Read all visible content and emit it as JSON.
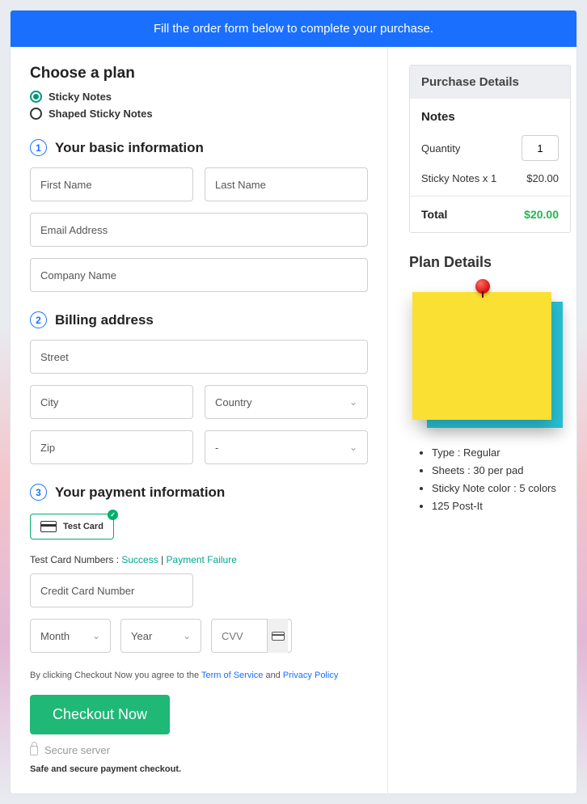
{
  "banner": "Fill the order form below to complete your purchase.",
  "plan": {
    "heading": "Choose a plan",
    "options": [
      "Sticky Notes",
      "Shaped Sticky Notes"
    ]
  },
  "steps": {
    "s1": {
      "num": "1",
      "title": "Your basic information",
      "first": "First Name",
      "last": "Last Name",
      "email": "Email Address",
      "company": "Company Name"
    },
    "s2": {
      "num": "2",
      "title": "Billing address",
      "street": "Street",
      "city": "City",
      "country": "Country",
      "zip": "Zip",
      "state": "-"
    },
    "s3": {
      "num": "3",
      "title": "Your payment information",
      "card_label": "Test  Card",
      "helper_prefix": "Test Card Numbers : ",
      "helper_success": "Success",
      "helper_sep": " | ",
      "helper_fail": "Payment Failure",
      "cc_placeholder": "Credit Card Number",
      "month": "Month",
      "year": "Year",
      "cvv": "CVV"
    }
  },
  "legal": {
    "prefix": "By clicking Checkout Now you agree to the ",
    "tos": "Term of Service",
    "and": " and ",
    "pp": "Privacy Policy"
  },
  "checkout": "Checkout Now",
  "secure": "Secure server",
  "safe": "Safe and secure payment checkout.",
  "summary": {
    "heading": "Purchase Details",
    "notes_h": "Notes",
    "qty_label": "Quantity",
    "qty_value": "1",
    "line_item": "Sticky Notes x 1",
    "line_price": "$20.00",
    "total_label": "Total",
    "total_price": "$20.00"
  },
  "details": {
    "heading": "Plan Details",
    "bullets": [
      "Type : Regular",
      "Sheets : 30 per pad",
      "Sticky Note color : 5 colors",
      "125 Post-It"
    ]
  }
}
